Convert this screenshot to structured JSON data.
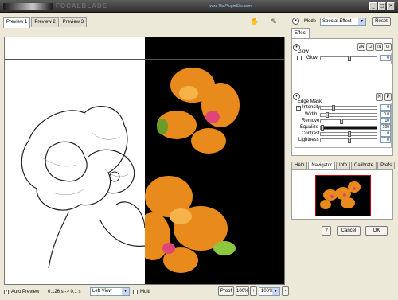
{
  "window": {
    "app_name": "FOCALBLADE",
    "url": "www.ThePluginSite.com",
    "min_label": "_",
    "max_label": "□",
    "close_label": "✕"
  },
  "preview_tabs": [
    "Preview 1",
    "Preview 2",
    "Preview 3"
  ],
  "right_panel": {
    "mode_label": "Mode",
    "mode_value": "Special Effect",
    "reset_label": "Reset",
    "effect_tab": "Effect",
    "glow": {
      "group_label": "Glow",
      "row_label": "Glow",
      "buttons": [
        "2N",
        "Cl",
        "2N",
        "Cl"
      ],
      "value": "0"
    },
    "edge_mask": {
      "group_label": "Edge Mask",
      "toggle_n": "N",
      "toggle_p": "P",
      "rows": [
        {
          "label": "Intensity",
          "checked": true,
          "value": "0"
        },
        {
          "label": "Width",
          "checked": false,
          "value": "0.0"
        },
        {
          "label": "Remove",
          "checked": false,
          "value": "10"
        },
        {
          "label": "Equalize",
          "checked": false,
          "value": "-100"
        },
        {
          "label": "Contrast",
          "checked": false,
          "value": "0"
        },
        {
          "label": "Lightness",
          "checked": false,
          "value": "0"
        }
      ]
    },
    "nav_tabs": [
      "Help",
      "Navigator",
      "Info",
      "Calibrate",
      "Prefs"
    ],
    "active_nav_tab": "Navigator",
    "help_button": "?",
    "cancel_button": "Cancel",
    "ok_button": "OK"
  },
  "bottom_bar": {
    "auto_preview_label": "Auto Preview",
    "auto_preview_checked": true,
    "timing": "0.126 s -> 0.1 s",
    "view_value": "Left View",
    "multi_label": "Multi",
    "proof_label": "Proof",
    "zoom_a": "100%",
    "zoom_b": "100%",
    "plus_label": "+",
    "minus_label": "-"
  }
}
